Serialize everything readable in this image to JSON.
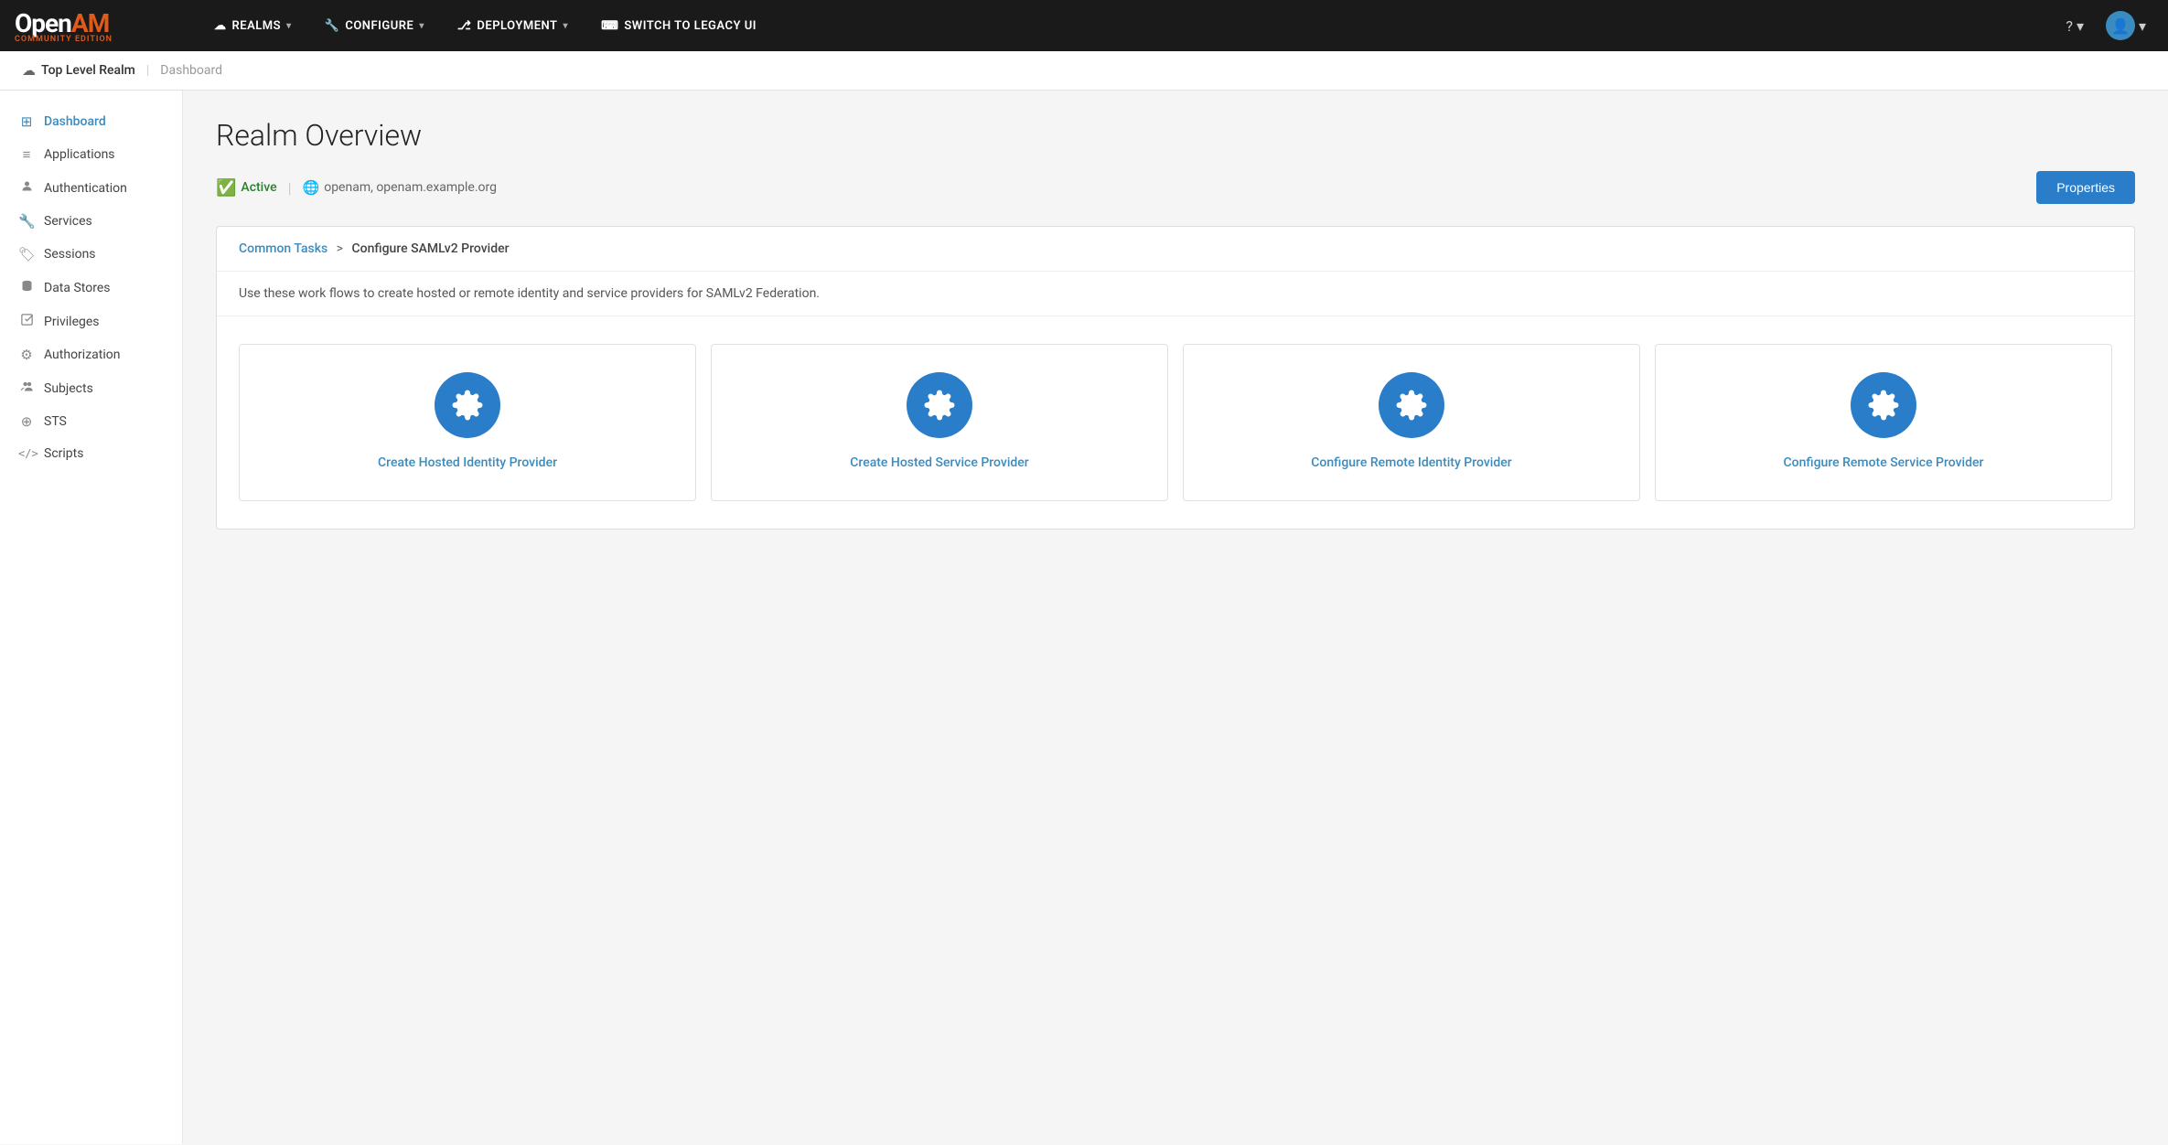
{
  "app": {
    "logo_open": "Open",
    "logo_am": "AM",
    "logo_sub": "COMMUNITY EDITION"
  },
  "topnav": {
    "items": [
      {
        "id": "realms",
        "label": "REALMS",
        "icon": "cloud"
      },
      {
        "id": "configure",
        "label": "CONFIGURE",
        "icon": "wrench"
      },
      {
        "id": "deployment",
        "label": "DEPLOYMENT",
        "icon": "sitemap"
      },
      {
        "id": "legacy",
        "label": "SWITCH TO LEGACY UI",
        "icon": "terminal"
      }
    ],
    "help_label": "?",
    "user_icon": "person"
  },
  "breadcrumb": {
    "realm_icon": "☁",
    "realm_label": "Top Level Realm",
    "page_label": "Dashboard"
  },
  "sidebar": {
    "items": [
      {
        "id": "dashboard",
        "label": "Dashboard",
        "icon": "⊞",
        "active": true
      },
      {
        "id": "applications",
        "label": "Applications",
        "icon": "≡"
      },
      {
        "id": "authentication",
        "label": "Authentication",
        "icon": "👤"
      },
      {
        "id": "services",
        "label": "Services",
        "icon": "🔧"
      },
      {
        "id": "sessions",
        "label": "Sessions",
        "icon": "🏷"
      },
      {
        "id": "datastores",
        "label": "Data Stores",
        "icon": "☰"
      },
      {
        "id": "privileges",
        "label": "Privileges",
        "icon": "☑"
      },
      {
        "id": "authorization",
        "label": "Authorization",
        "icon": "⚙"
      },
      {
        "id": "subjects",
        "label": "Subjects",
        "icon": "👥"
      },
      {
        "id": "sts",
        "label": "STS",
        "icon": "⊕"
      },
      {
        "id": "scripts",
        "label": "Scripts",
        "icon": "</>"
      }
    ]
  },
  "main": {
    "page_title": "Realm Overview",
    "status_label": "Active",
    "realm_info": "openam, openam.example.org",
    "properties_button": "Properties",
    "tasks_breadcrumb_link": "Common Tasks",
    "tasks_breadcrumb_sep": ">",
    "tasks_breadcrumb_current": "Configure SAMLv2 Provider",
    "tasks_description": "Use these work flows to create hosted or remote identity and service providers for SAMLv2 Federation.",
    "task_cards": [
      {
        "id": "create-hosted-idp",
        "label": "Create Hosted Identity Provider"
      },
      {
        "id": "create-hosted-sp",
        "label": "Create Hosted Service Provider"
      },
      {
        "id": "configure-remote-idp",
        "label": "Configure Remote Identity Provider"
      },
      {
        "id": "configure-remote-sp",
        "label": "Configure Remote Service Provider"
      }
    ]
  }
}
